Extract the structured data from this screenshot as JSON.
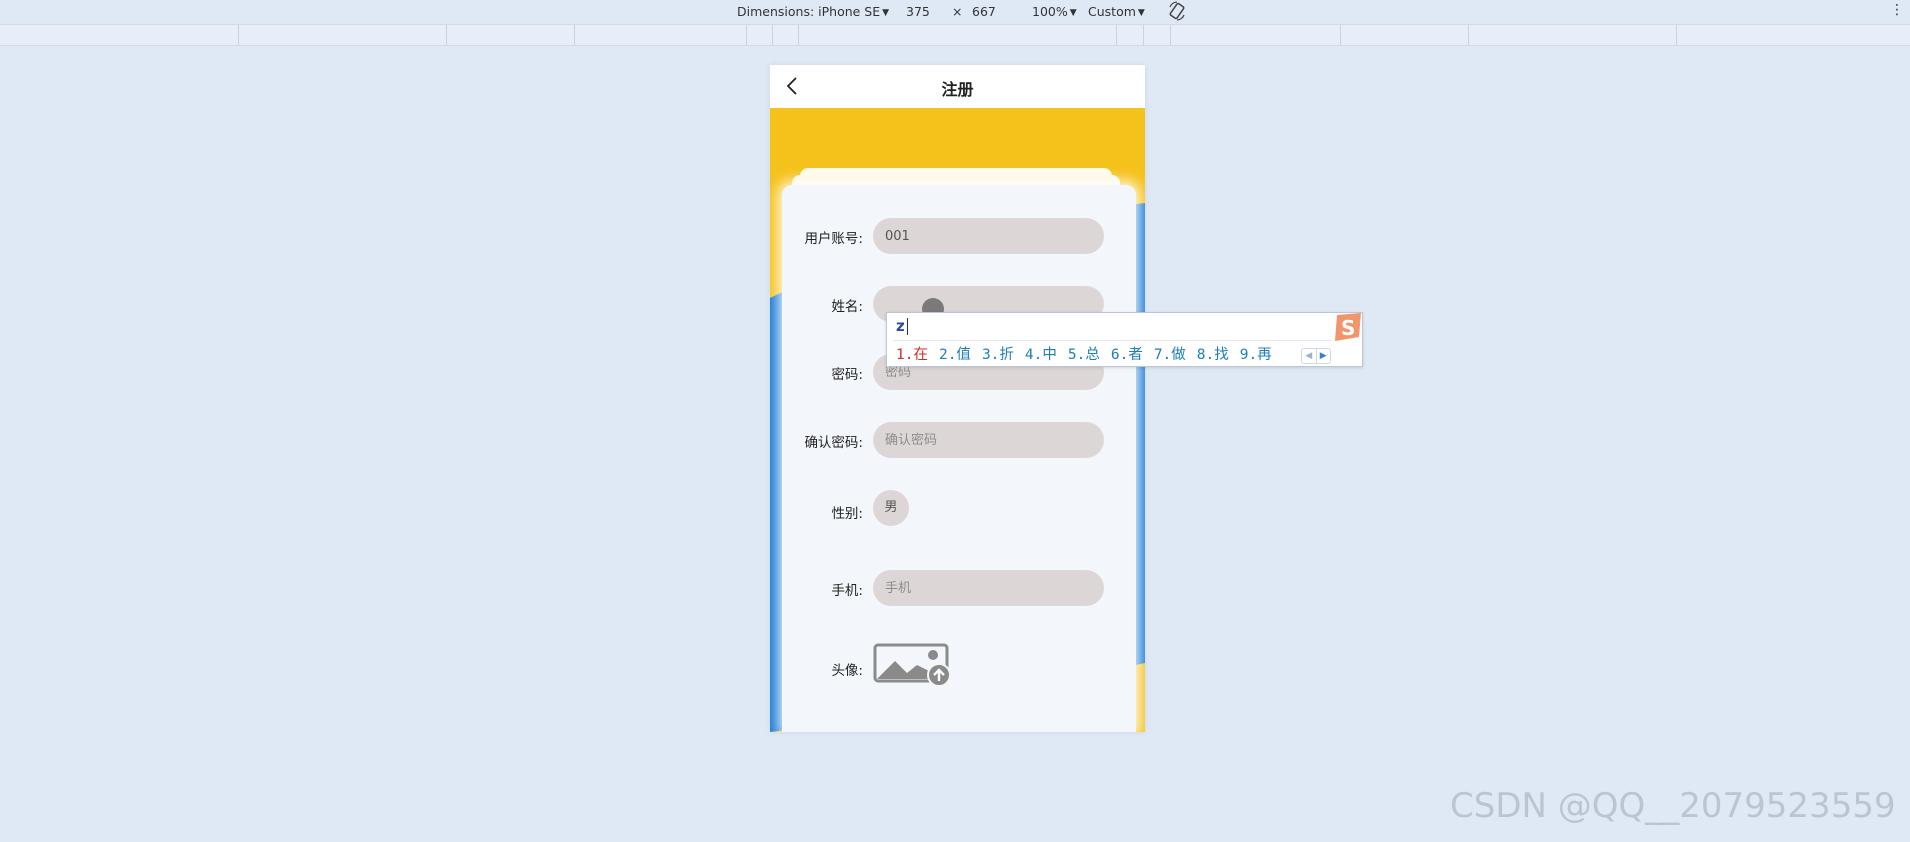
{
  "devtools": {
    "dimensions_label": "Dimensions: iPhone SE",
    "width": "375",
    "times": "×",
    "height": "667",
    "zoom": "100%",
    "throttle": "Custom"
  },
  "page": {
    "title": "注册",
    "fields": {
      "account": {
        "label": "用户账号:",
        "value": "001",
        "placeholder": ""
      },
      "name": {
        "label": "姓名:",
        "value": "",
        "placeholder": ""
      },
      "password": {
        "label": "密码:",
        "value": "",
        "placeholder": "密码"
      },
      "confirm": {
        "label": "确认密码:",
        "value": "",
        "placeholder": "确认密码"
      },
      "gender": {
        "label": "性别:",
        "value": "男"
      },
      "phone": {
        "label": "手机:",
        "value": "",
        "placeholder": "手机"
      },
      "avatar": {
        "label": "头像:"
      }
    }
  },
  "ime": {
    "input": "z",
    "candidates": [
      "1.在",
      "2.值",
      "3.折",
      "4.中",
      "5.总",
      "6.者",
      "7.做",
      "8.找",
      "9.再"
    ]
  },
  "watermark": "CSDN @QQ__2079523559",
  "colors": {
    "yellow": "#f5c21b",
    "blue": "#1477d4",
    "input_bg": "#ddd6d6"
  }
}
